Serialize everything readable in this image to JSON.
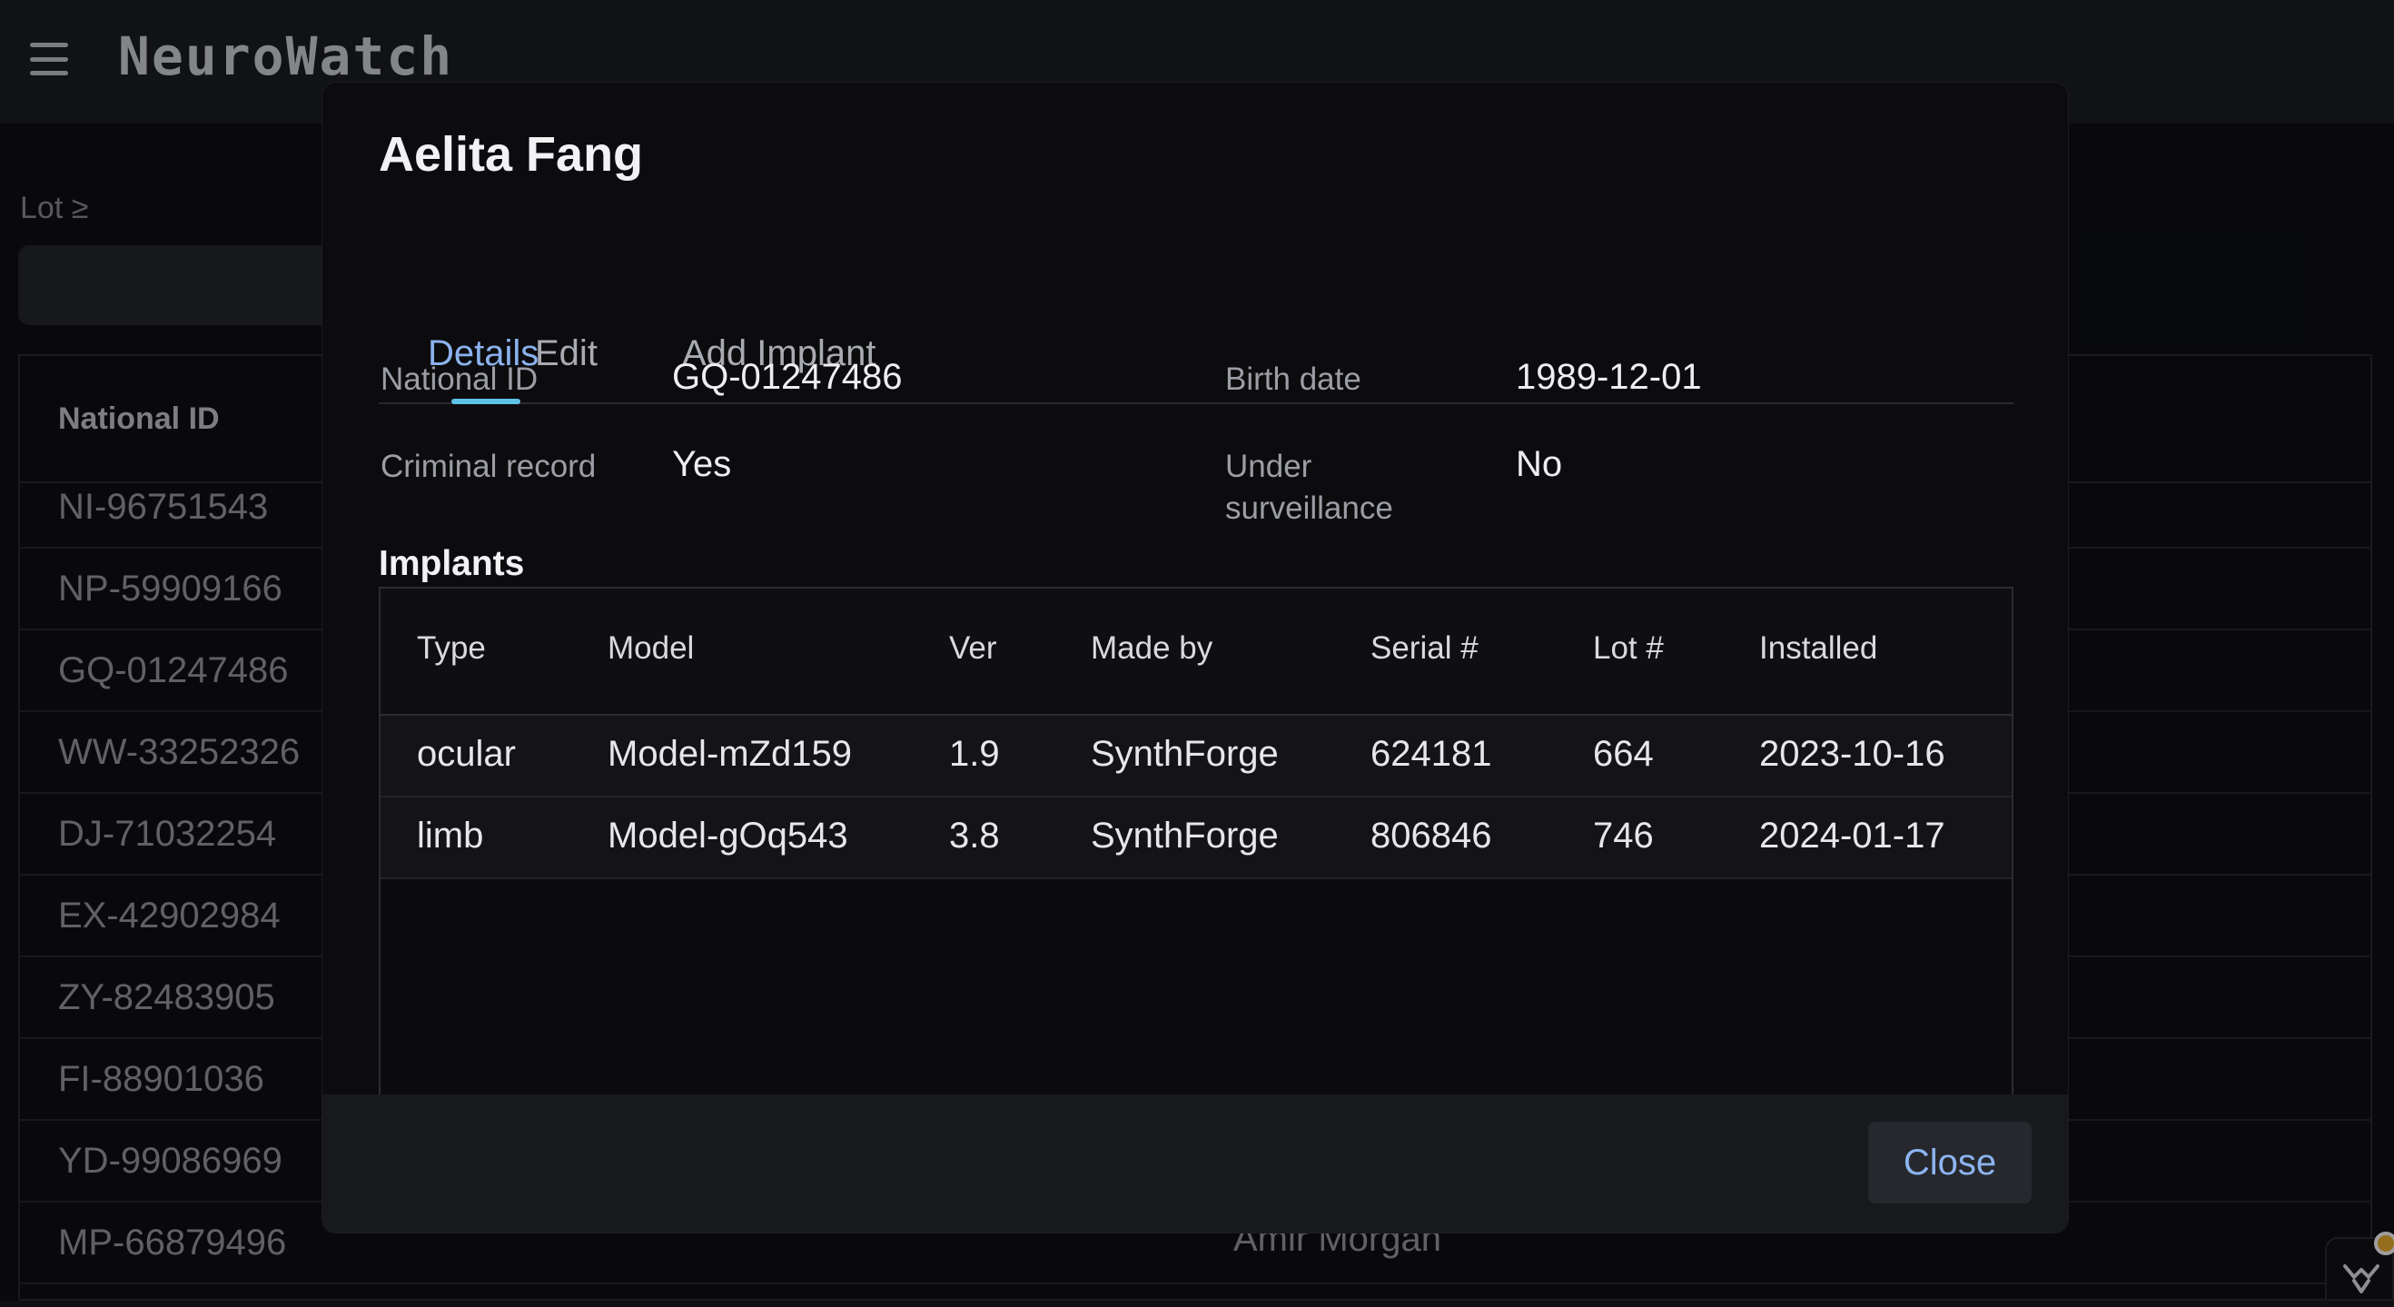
{
  "app": {
    "title": "NeuroWatch"
  },
  "filter": {
    "label": "Lot ≥",
    "value": ""
  },
  "table": {
    "header_national_id": "National ID",
    "rows": [
      {
        "id": "NI-96751543",
        "owner": ""
      },
      {
        "id": "NP-59909166",
        "owner": ""
      },
      {
        "id": "GQ-01247486",
        "owner": ""
      },
      {
        "id": "WW-33252326",
        "owner": ""
      },
      {
        "id": "DJ-71032254",
        "owner": ""
      },
      {
        "id": "EX-42902984",
        "owner": ""
      },
      {
        "id": "ZY-82483905",
        "owner": ""
      },
      {
        "id": "FI-88901036",
        "owner": ""
      },
      {
        "id": "YD-99086969",
        "owner": ""
      },
      {
        "id": "MP-66879496",
        "owner": "Amir Morgan"
      }
    ]
  },
  "modal": {
    "title": "Aelita Fang",
    "tabs": [
      {
        "label": "Details",
        "active": true
      },
      {
        "label": "Edit",
        "active": false
      },
      {
        "label": "Add Implant",
        "active": false
      }
    ],
    "fields": {
      "national_id": {
        "label": "National ID",
        "value": "GQ-01247486"
      },
      "birth_date": {
        "label": "Birth date",
        "value": "1989-12-01"
      },
      "criminal_record": {
        "label": "Criminal record",
        "value": "Yes"
      },
      "under_surveillance": {
        "label": "Under surveillance",
        "value": "No"
      }
    },
    "implants": {
      "heading": "Implants",
      "columns": [
        "Type",
        "Model",
        "Ver",
        "Made by",
        "Serial #",
        "Lot #",
        "Installed"
      ],
      "rows": [
        [
          "ocular",
          "Model-mZd159",
          "1.9",
          "SynthForge",
          "624181",
          "664",
          "2023-10-16"
        ],
        [
          "limb",
          "Model-gOq543",
          "3.8",
          "SynthForge",
          "806846",
          "746",
          "2024-01-17"
        ]
      ]
    },
    "close_label": "Close"
  },
  "colors": {
    "accent": "#8bb2ee",
    "tab_indicator": "#5ec2e8",
    "badge": "#f0b12c"
  },
  "icons": {
    "menu": "hamburger-menu-icon",
    "dev_tools": "bug-icon"
  }
}
